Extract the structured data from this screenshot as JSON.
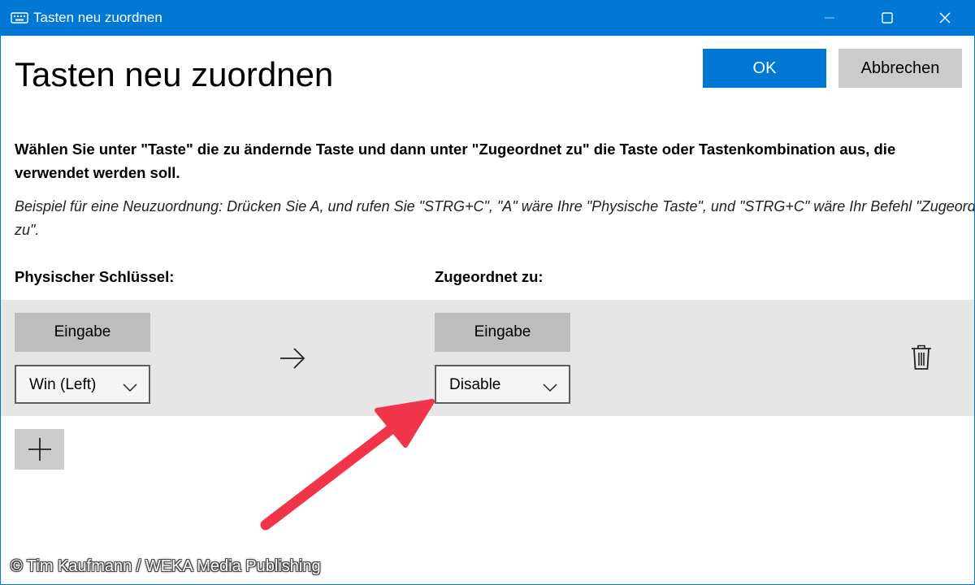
{
  "window": {
    "title": "Tasten neu zuordnen",
    "icon": "keyboard-icon"
  },
  "page": {
    "heading": "Tasten neu zuordnen",
    "ok_label": "OK",
    "cancel_label": "Abbrechen",
    "instruction": "Wählen Sie unter \"Taste\" die zu ändernde Taste und dann unter \"Zugeordnet zu\" die Taste oder Tastenkombination aus, die verwendet werden soll.",
    "example": "Beispiel für eine Neuzuordnung: Drücken Sie A, und rufen Sie \"STRG+C\", \"A\" wäre Ihre \"Physische Taste\", und \"STRG+C\" wäre Ihr Befehl \"Zugeordnet zu\".",
    "physical_label": "Physischer Schlüssel:",
    "mapped_label": "Zugeordnet zu:"
  },
  "mapping_rows": [
    {
      "physical_type_label": "Eingabe",
      "physical_value": "Win (Left)",
      "mapped_type_label": "Eingabe",
      "mapped_value": "Disable"
    }
  ],
  "credit": "© Tim Kaufmann / WEKA Media Publishing",
  "colors": {
    "accent": "#0078d4",
    "annotation_arrow": "#f0344a"
  }
}
